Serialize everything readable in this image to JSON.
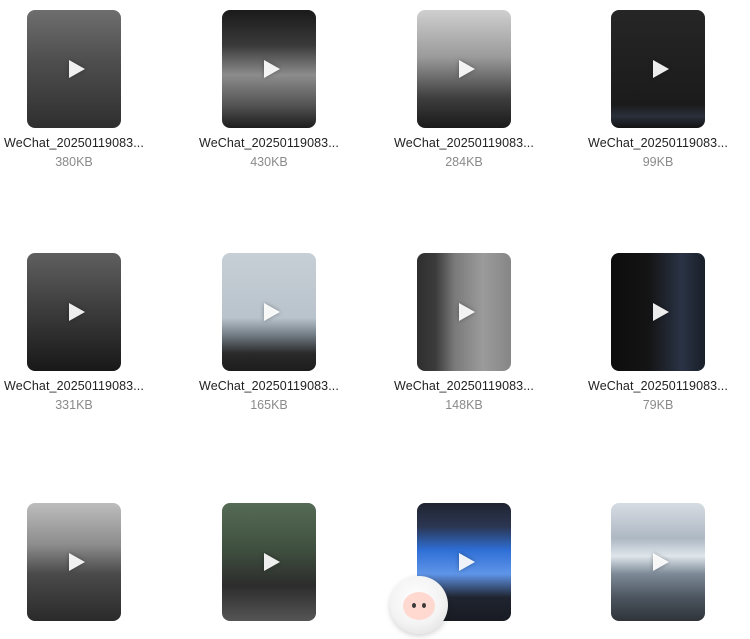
{
  "files": [
    {
      "name": "WeChat_20250119083...",
      "size": "380KB",
      "thumb": "t0"
    },
    {
      "name": "WeChat_20250119083...",
      "size": "430KB",
      "thumb": "t1"
    },
    {
      "name": "WeChat_20250119083...",
      "size": "284KB",
      "thumb": "t2"
    },
    {
      "name": "WeChat_20250119083...",
      "size": "99KB",
      "thumb": "t3"
    },
    {
      "name": "WeChat_20250119083...",
      "size": "331KB",
      "thumb": "t4"
    },
    {
      "name": "WeChat_20250119083...",
      "size": "165KB",
      "thumb": "t5"
    },
    {
      "name": "WeChat_20250119083...",
      "size": "148KB",
      "thumb": "t6"
    },
    {
      "name": "WeChat_20250119083...",
      "size": "79KB",
      "thumb": "t7"
    },
    {
      "name": "",
      "size": "",
      "thumb": "t8"
    },
    {
      "name": "",
      "size": "",
      "thumb": "t9"
    },
    {
      "name": "",
      "size": "",
      "thumb": "t10"
    },
    {
      "name": "",
      "size": "",
      "thumb": "t11"
    }
  ],
  "icons": {
    "play": "play-icon",
    "mascot": "assistant-mascot-icon"
  },
  "colors": {
    "text": "#222222",
    "muted": "#8a8a8a",
    "background": "#ffffff"
  }
}
